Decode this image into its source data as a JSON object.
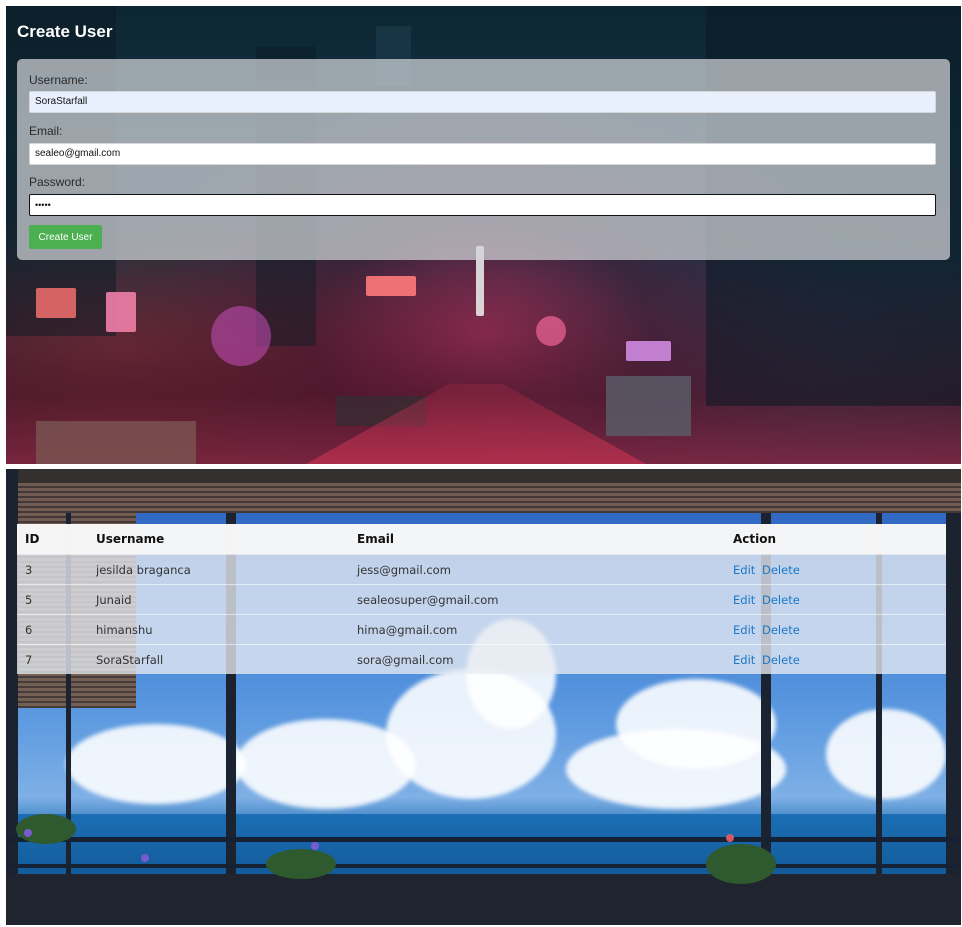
{
  "create_form": {
    "title": "Create User",
    "fields": [
      {
        "label": "Username:",
        "value": "SoraStarfall"
      },
      {
        "label": "Email:",
        "value": "sealeo@gmail.com"
      },
      {
        "label": "Password:",
        "value": "•••••"
      }
    ],
    "submit_label": "Create User",
    "submit_color": "#4caf50"
  },
  "users_table": {
    "columns": [
      "ID",
      "Username",
      "Email",
      "Action"
    ],
    "rows": [
      {
        "id": "3",
        "username": "jesilda braganca",
        "email": "jess@gmail.com",
        "edit": "Edit",
        "delete": "Delete"
      },
      {
        "id": "5",
        "username": "Junaid",
        "email": "sealeosuper@gmail.com",
        "edit": "Edit",
        "delete": "Delete"
      },
      {
        "id": "6",
        "username": "himanshu",
        "email": "hima@gmail.com",
        "edit": "Edit",
        "delete": "Delete"
      },
      {
        "id": "7",
        "username": "SoraStarfall",
        "email": "sora@gmail.com",
        "edit": "Edit",
        "delete": "Delete"
      }
    ],
    "link_color": "#1a78c8"
  }
}
